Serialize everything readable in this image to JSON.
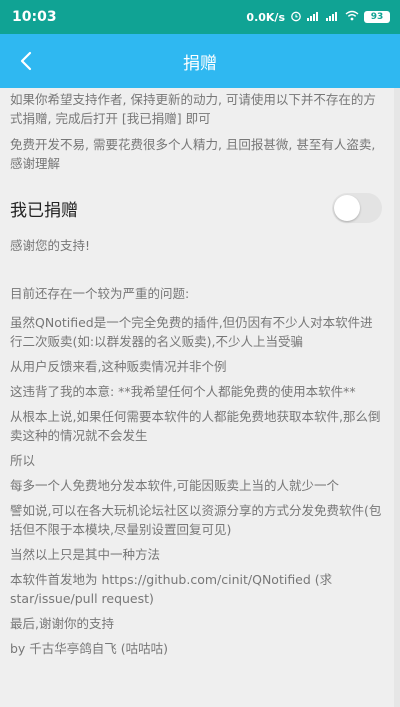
{
  "status_bar": {
    "time": "10:03",
    "speed": "0.0K/s",
    "alarm_icon": "alarm-icon",
    "signal1": "ᴴᴰ ıll",
    "signal2": "ıll",
    "wifi_icon": "wifi-icon",
    "battery": "93",
    "background": "#10a394"
  },
  "app_bar": {
    "title": "捐赠",
    "back_icon": "back-arrow-icon",
    "background": "#2fb8f1"
  },
  "intro": [
    "如果你希望支持作者, 保持更新的动力, 可请使用以下并不存在的方式捐赠, 完成后打开 [我已捐赠] 即可",
    "免费开发不易, 需要花费很多个人精力, 且回报甚微, 甚至有人盗卖, 感谢理解"
  ],
  "donated_toggle": {
    "label": "我已捐赠",
    "state": "off"
  },
  "thanks": "感谢您的支持!",
  "info": [
    "目前还存在一个较为严重的问题:",
    "   虽然QNotified是一个完全免费的插件,但仍因有不少人对本软件进行二次贩卖(如:以群发器的名义贩卖),不少人上当受骗",
    "从用户反馈来看,这种贩卖情况并非个例",
    "这违背了我的本意: **我希望任何个人都能免费的使用本软件**",
    "从根本上说,如果任何需要本软件的人都能免费地获取本软件,那么倒卖这种的情况就不会发生",
    "所以",
    "每多一个人免费地分发本软件,可能因贩卖上当的人就少一个",
    "譬如说,可以在各大玩机论坛社区以资源分享的方式分发免费软件(包括但不限于本模块,尽量别设置回复可见)",
    "当然以上只是其中一种方法",
    "本软件首发地为 https://github.com/cinit/QNotified (求star/issue/pull request)",
    "最后,谢谢你的支持",
    "by 千古华亭鸽自飞 (咕咕咕)"
  ]
}
